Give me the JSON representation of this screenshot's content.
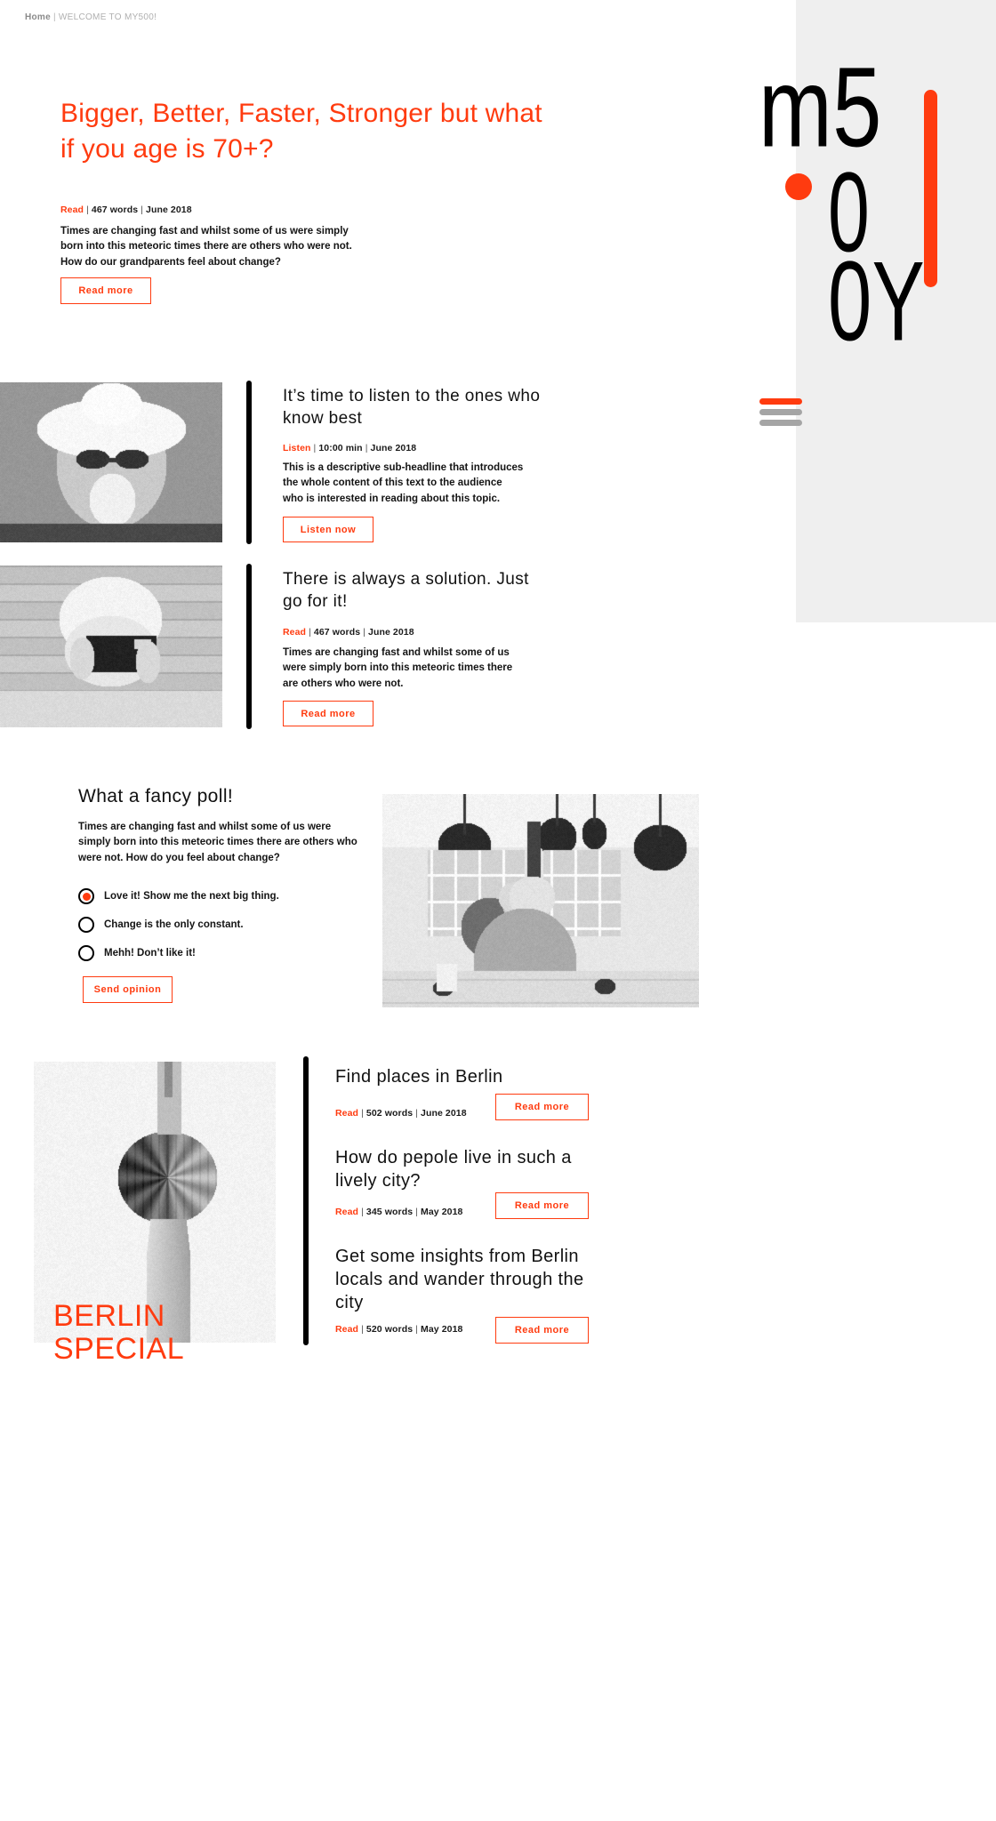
{
  "theme": {
    "accent": "#ff3b0f",
    "ink": "#111111",
    "panel_bg": "#efefef",
    "muted": "#9a9a9a"
  },
  "breadcrumb": {
    "home": "Home",
    "separator": "|",
    "current": "WELCOME TO MY500!"
  },
  "logo": {
    "line_1": "m5",
    "line_2": "0",
    "line_3": "0Y",
    "dot": "orange-dot",
    "bar": "orange-bar"
  },
  "menu": {
    "label": "hamburger-menu"
  },
  "hero": {
    "title": "Bigger, Better, Faster, Stronger but what if you age is 70+?",
    "meta": {
      "kind": "Read",
      "length": "467 words",
      "date": "June 2018",
      "sep": "|"
    },
    "copy": "Times are changing fast and whilst some of us were simply born into this meteoric times there are others who were not. How do our grandparents feel about change?",
    "button": "Read more"
  },
  "articles": [
    {
      "title": "It’s time to listen to the ones who know best",
      "meta": {
        "kind": "Listen",
        "length": "10:00 min",
        "date": "June 2018",
        "sep": "|"
      },
      "copy": "This is a descriptive sub-headline that introduces the whole content of this text to the audience who is interested in reading about this topic.",
      "button": "Listen now",
      "image_alt": "elderly-man-in-cowboy-hat-and-sunglasses"
    },
    {
      "title": "There is always a solution. Just go for it!",
      "meta": {
        "kind": "Read",
        "length": "467 words",
        "date": "June 2018",
        "sep": "|"
      },
      "copy": "Times are changing fast and whilst some of us were simply born into this meteoric times there are others who were not.",
      "button": "Read more",
      "image_alt": "elderly-woman-holding-a-film-camera"
    }
  ],
  "poll": {
    "title": "What a fancy poll!",
    "copy": "Times are changing fast and whilst some of us were simply born into this meteoric times there are others who were not. How do you feel about change?",
    "options": [
      {
        "label": "Love it! Show me the next big thing.",
        "selected": true
      },
      {
        "label": "Change is the only constant.",
        "selected": false
      },
      {
        "label": "Mehh! Don’t like it!",
        "selected": false
      }
    ],
    "button": "Send opinion",
    "image_alt": "elderly-people-sitting-in-a-cafe"
  },
  "berlin": {
    "overlay_line_1": "BERLIN",
    "overlay_line_2": "SPECIAL",
    "image_alt": "berlin-tv-tower-seen-from-below",
    "items": [
      {
        "title": "Find places in Berlin",
        "meta": {
          "kind": "Read",
          "length": "502 words",
          "date": "June 2018",
          "sep": "|"
        },
        "button": "Read more"
      },
      {
        "title": "How do pepole live in such a lively city?",
        "meta": {
          "kind": "Read",
          "length": "345 words",
          "date": "May 2018",
          "sep": "|"
        },
        "button": "Read more"
      },
      {
        "title": "Get some insights from Berlin locals and wander through the city",
        "meta": {
          "kind": "Read",
          "length": "520 words",
          "date": "May 2018",
          "sep": "|"
        },
        "button": "Read more"
      }
    ]
  }
}
